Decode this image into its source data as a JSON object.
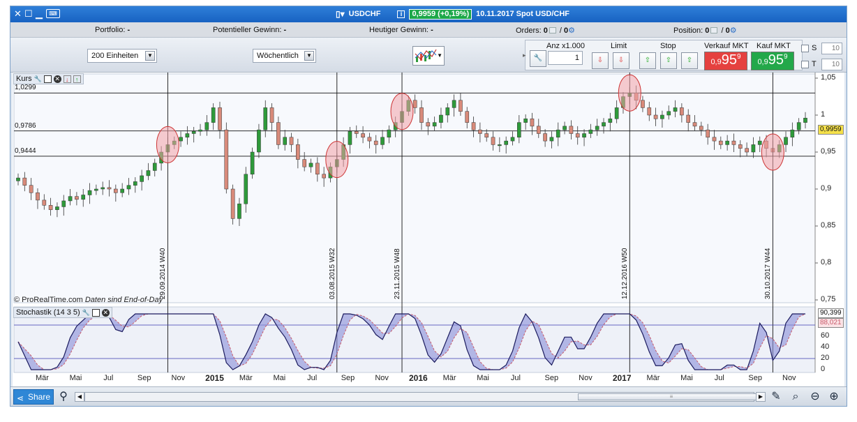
{
  "titlebar": {
    "symbol": "USDCHF",
    "price_badge": "0,9959 (+0,19%)",
    "date_info": "10.11.2017 Spot USD/CHF"
  },
  "infobar": {
    "portfolio_label": "Portfolio:",
    "portfolio_value": "-",
    "potential_label": "Potentieller Gewinn:",
    "potential_value": "-",
    "today_label": "Heutiger Gewinn:",
    "today_value": "-",
    "orders_label": "Orders:",
    "orders_a": "0",
    "orders_b": "0",
    "position_label": "Position:",
    "position_a": "0",
    "position_b": "0"
  },
  "toolbar": {
    "units_select": "200 Einheiten",
    "period_select": "Wöchentlich",
    "qty_label": "Anz x1.000",
    "qty_value": "1",
    "limit_label": "Limit",
    "stop_label": "Stop",
    "sell_label": "Verkauf MKT",
    "buy_label": "Kauf MKT",
    "sell_small": "0,9",
    "sell_big": "95",
    "sell_sup": "9",
    "buy_small": "0,9",
    "buy_big": "95",
    "buy_sup": "9",
    "s_label": "S",
    "t_label": "T",
    "s_value": "10",
    "t_value": "10"
  },
  "colors": {
    "bull": "#2e9a3a",
    "bear": "#d88a7a",
    "highlight": "#f3a3a8",
    "sell_btn": "#e5413f",
    "buy_btn": "#23a84a",
    "stoch_k": "#1b1b5e",
    "stoch_d": "#c85a6a"
  },
  "chart": {
    "kurs_label": "Kurs",
    "stoch_label": "Stochastik (14 3 5)",
    "copyright": "© ProRealTime.com",
    "copyright_note": "Daten sind End-of-Day",
    "current_price": "0,9959",
    "stoch_k_value": "90,399",
    "stoch_d_value": "88,021"
  },
  "chart_data": {
    "type": "candlestick",
    "price_axis": {
      "ticks": [
        "1,05",
        "1",
        "0,95",
        "0,9",
        "0,85",
        "0,8",
        "0,75"
      ],
      "range": [
        0.75,
        1.05
      ]
    },
    "stoch_axis": {
      "ticks": [
        "60",
        "40",
        "20",
        "0"
      ],
      "range": [
        0,
        100
      ],
      "levels": [
        80,
        20
      ]
    },
    "horizontal_lines": [
      {
        "label": "1,0299",
        "value": 1.0299
      },
      {
        "label": "0,9786",
        "value": 0.9786
      },
      {
        "label": "0,9444",
        "value": 0.9444
      }
    ],
    "vertical_markers": [
      {
        "label": "29.09.2014 W40"
      },
      {
        "label": "03.08.2015 W32"
      },
      {
        "label": "23.11.2015 W48"
      },
      {
        "label": "12.12.2016 W50"
      },
      {
        "label": "30.10.2017 W44"
      }
    ],
    "x_axis_labels": [
      "Mär",
      "Mai",
      "Jul",
      "Sep",
      "Nov",
      "2015",
      "Mär",
      "Mai",
      "Jul",
      "Sep",
      "Nov",
      "2016",
      "Mär",
      "Mai",
      "Jul",
      "Sep",
      "Nov",
      "2017",
      "Mär",
      "Mai",
      "Jul",
      "Sep",
      "Nov"
    ],
    "close_path": [
      0.915,
      0.905,
      0.895,
      0.885,
      0.878,
      0.872,
      0.876,
      0.884,
      0.89,
      0.886,
      0.892,
      0.898,
      0.9,
      0.902,
      0.9,
      0.895,
      0.9,
      0.905,
      0.91,
      0.918,
      0.925,
      0.935,
      0.95,
      0.96,
      0.965,
      0.97,
      0.975,
      0.978,
      0.98,
      0.99,
      1.01,
      0.98,
      0.9,
      0.86,
      0.88,
      0.92,
      0.95,
      0.98,
      1.01,
      0.99,
      0.96,
      0.97,
      0.96,
      0.94,
      0.93,
      0.935,
      0.92,
      0.915,
      0.93,
      0.94,
      0.96,
      0.978,
      0.975,
      0.97,
      0.965,
      0.96,
      0.97,
      0.98,
      0.99,
      1.005,
      1.02,
      1.01,
      0.99,
      0.985,
      0.99,
      1.0,
      1.01,
      1.02,
      1.005,
      0.99,
      0.98,
      0.975,
      0.97,
      0.96,
      0.96,
      0.965,
      0.97,
      0.99,
      0.995,
      0.985,
      0.975,
      0.965,
      0.97,
      0.98,
      0.985,
      0.975,
      0.97,
      0.975,
      0.98,
      0.985,
      0.99,
      0.995,
      1.01,
      1.025,
      1.03,
      1.02,
      1.01,
      1.0,
      0.995,
      1.0,
      1.005,
      1.01,
      1.0,
      0.99,
      0.985,
      0.98,
      0.97,
      0.965,
      0.96,
      0.965,
      0.96,
      0.955,
      0.95,
      0.96,
      0.965,
      0.955,
      0.95,
      0.96,
      0.97,
      0.98,
      0.99,
      0.996
    ]
  },
  "bottombar": {
    "share_label": "Share"
  }
}
